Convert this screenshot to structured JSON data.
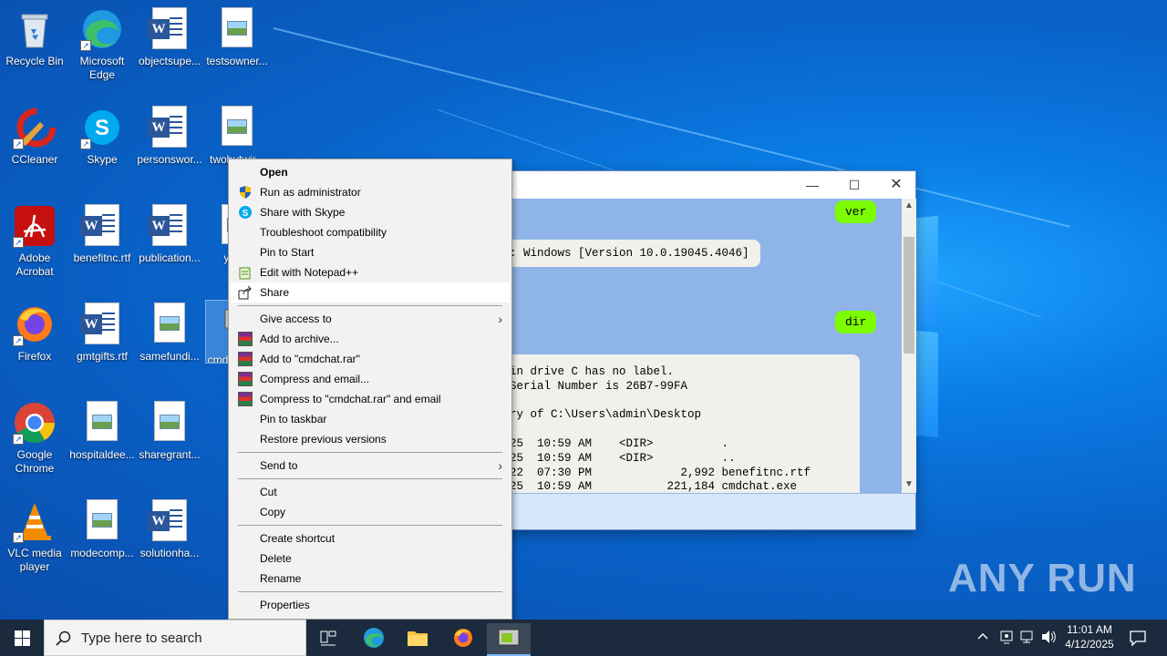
{
  "desktop": {
    "icons": [
      {
        "label": "Recycle Bin"
      },
      {
        "label": "Microsoft Edge"
      },
      {
        "label": "objectsupe..."
      },
      {
        "label": "testsowner..."
      },
      {
        "label": "CCleaner"
      },
      {
        "label": "Skype"
      },
      {
        "label": "personswor..."
      },
      {
        "label": "twobutwir..."
      },
      {
        "label": "Adobe Acrobat"
      },
      {
        "label": "benefitnc.rtf"
      },
      {
        "label": "publication..."
      },
      {
        "label": "yah..."
      },
      {
        "label": "Firefox"
      },
      {
        "label": "gmtgifts.rtf"
      },
      {
        "label": "samefundi..."
      },
      {
        "label": "cmd..."
      },
      {
        "label": "Google Chrome"
      },
      {
        "label": "hospitaldee..."
      },
      {
        "label": "sharegrant..."
      },
      {
        "label": "VLC media player"
      },
      {
        "label": "modecomp..."
      },
      {
        "label": "solutionha..."
      }
    ]
  },
  "cmdchat": {
    "title_fragment": ")",
    "messages": {
      "user1": "ver",
      "out1": ": Windows [Version 10.0.19045.4046]",
      "user2": "dir",
      "out2": "in drive C has no label.\nSerial Number is 26B7-99FA\n\nry of C:\\Users\\admin\\Desktop\n\n25  10:59 AM    <DIR>          .\n25  10:59 AM    <DIR>          ..\n22  07:30 PM             2,992 benefitnc.rtf\n25  10:59 AM           221,184 cmdchat.exe"
    }
  },
  "context_menu": {
    "items": [
      {
        "label": "Open"
      },
      {
        "label": "Run as administrator"
      },
      {
        "label": "Share with Skype"
      },
      {
        "label": "Troubleshoot compatibility"
      },
      {
        "label": "Pin to Start"
      },
      {
        "label": "Edit with Notepad++"
      },
      {
        "label": "Share"
      },
      {
        "label": "Give access to"
      },
      {
        "label": "Add to archive..."
      },
      {
        "label": "Add to \"cmdchat.rar\""
      },
      {
        "label": "Compress and email..."
      },
      {
        "label": "Compress to \"cmdchat.rar\" and email"
      },
      {
        "label": "Pin to taskbar"
      },
      {
        "label": "Restore previous versions"
      },
      {
        "label": "Send to"
      },
      {
        "label": "Cut"
      },
      {
        "label": "Copy"
      },
      {
        "label": "Create shortcut"
      },
      {
        "label": "Delete"
      },
      {
        "label": "Rename"
      },
      {
        "label": "Properties"
      }
    ]
  },
  "watermark": "ANY RUN",
  "taskbar": {
    "search_placeholder": "Type here to search",
    "time": "11:01 AM",
    "date": "4/12/2025"
  },
  "colors": {
    "user_bubble": "#7cfc00",
    "chat_bg": "#8fb4e8",
    "taskbar": "#1b2a3d"
  }
}
